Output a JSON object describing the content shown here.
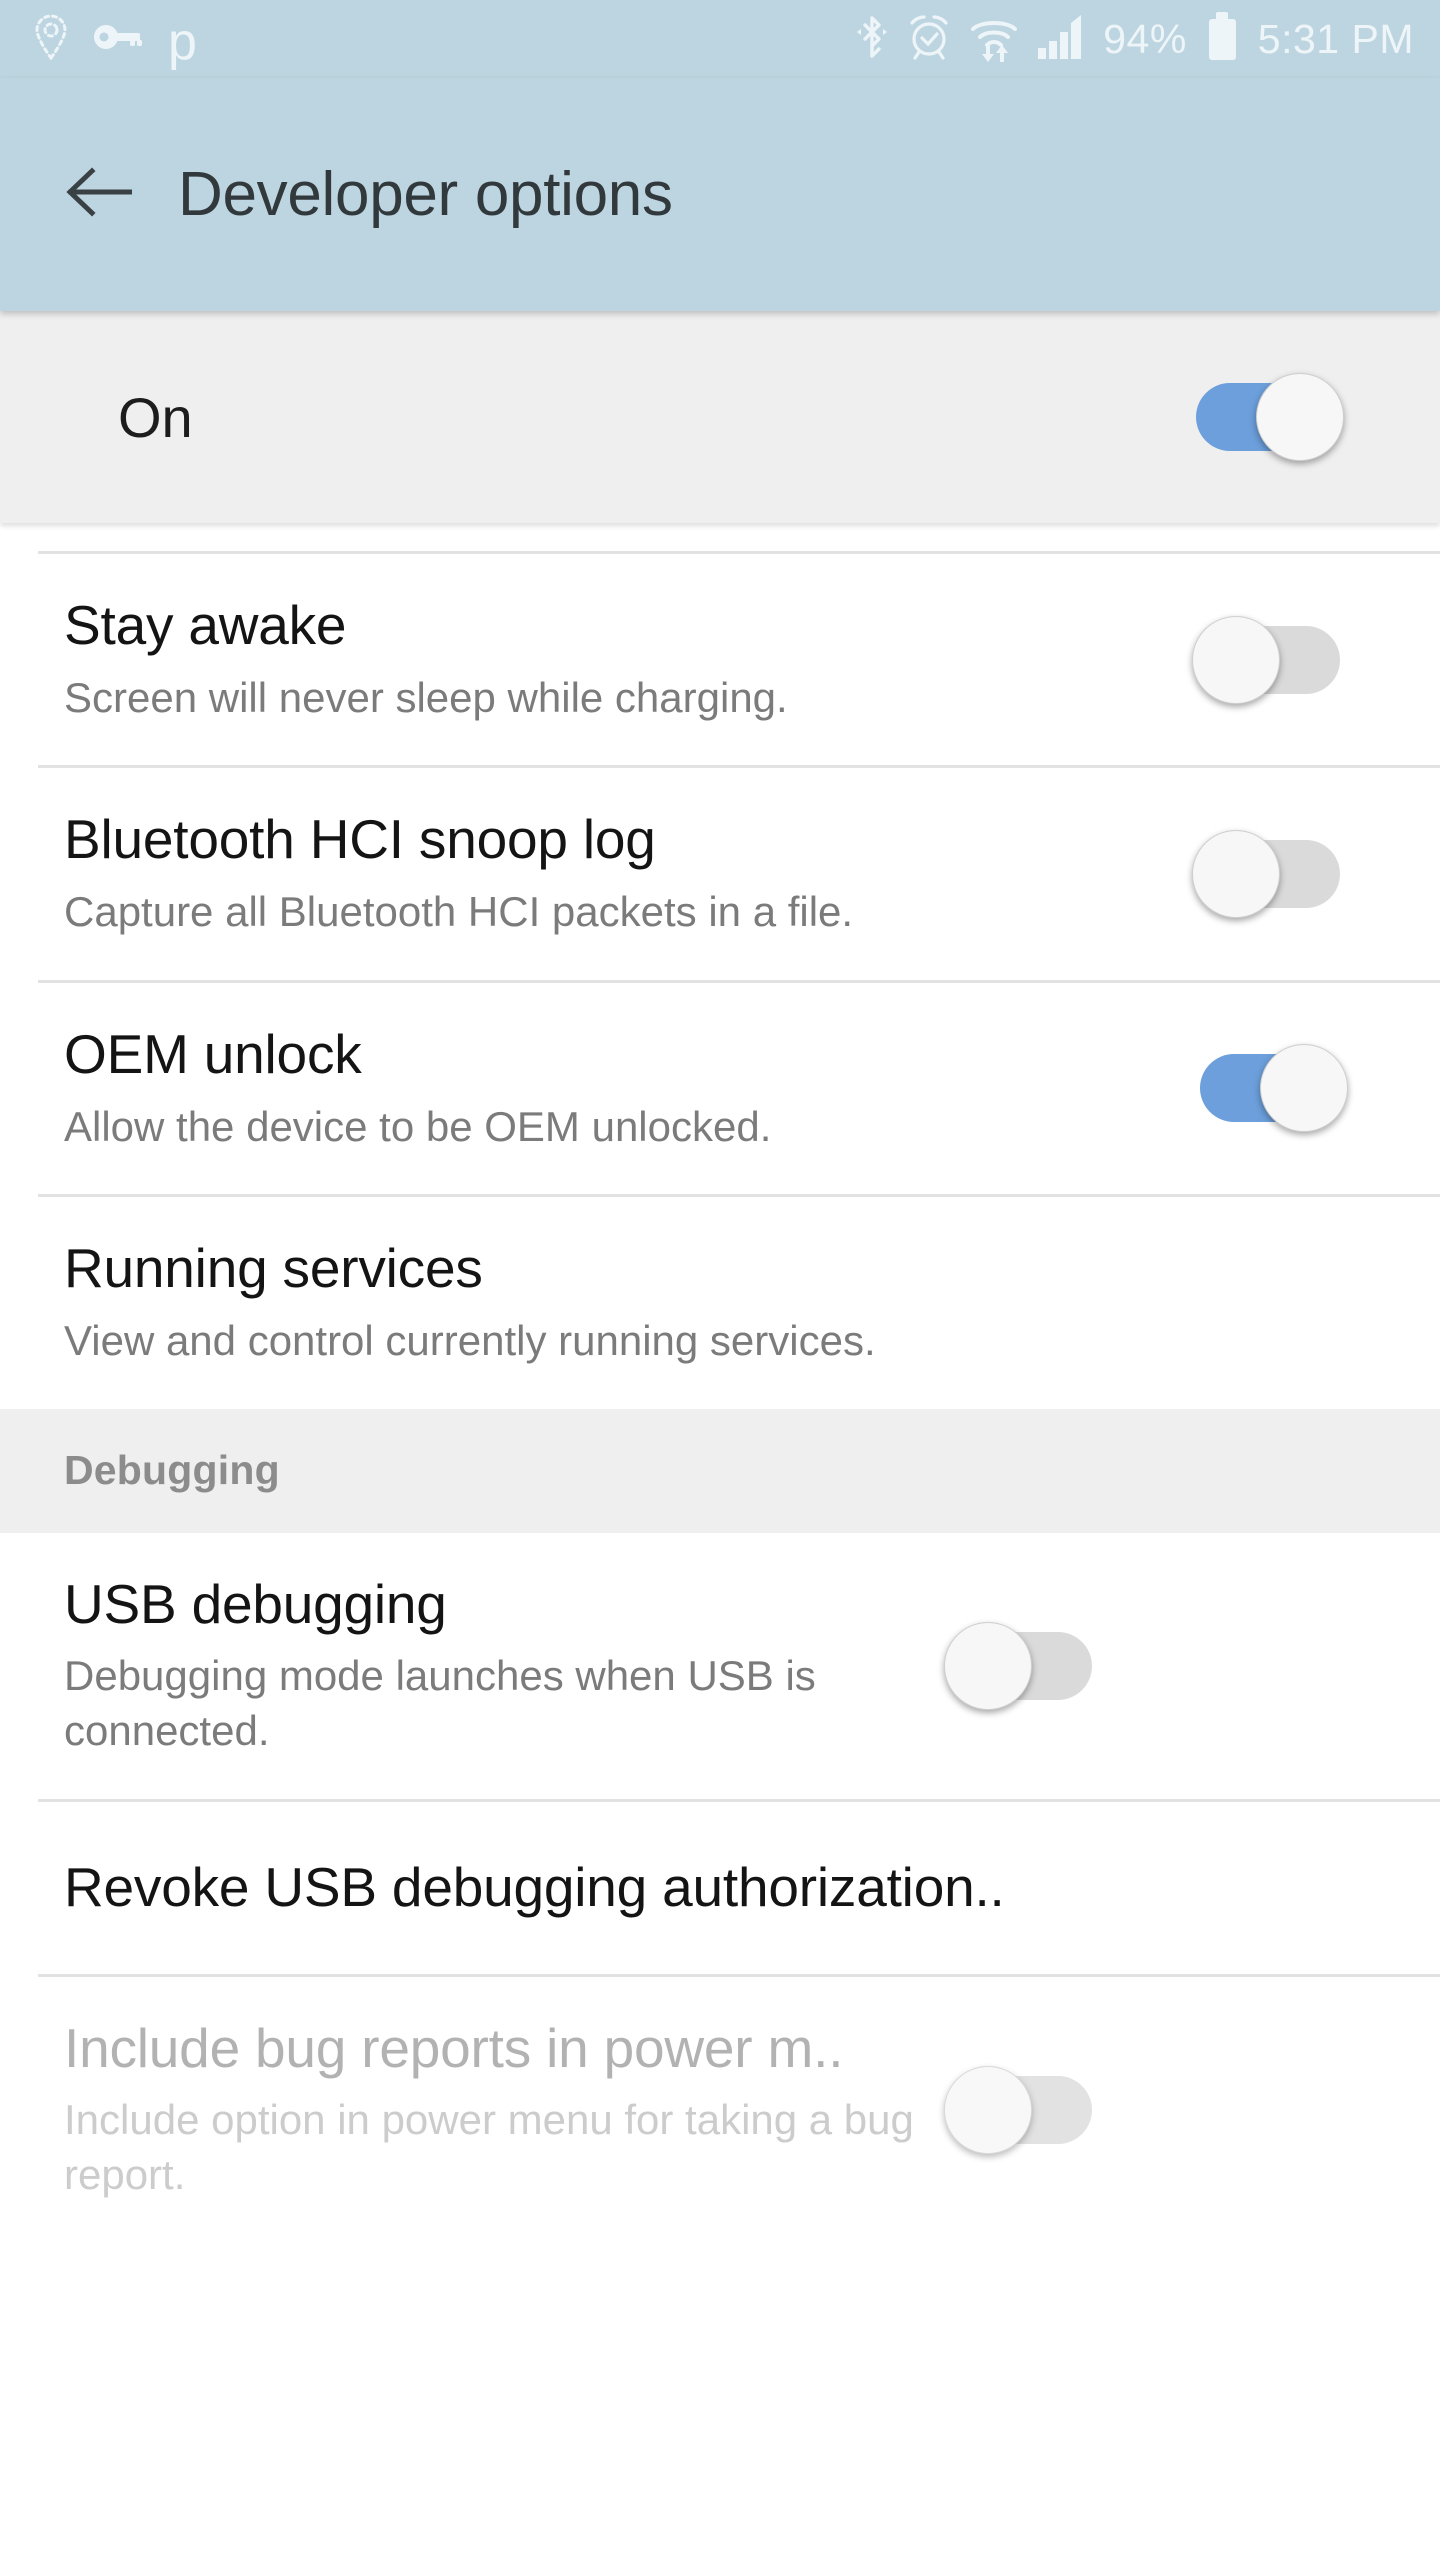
{
  "status_bar": {
    "background_color": "#bdd5e0",
    "icon_color": "#eef5f8",
    "left_icons": [
      {
        "name": "location-pin-icon"
      },
      {
        "name": "vpn-key-icon"
      },
      {
        "name": "app-p-icon",
        "glyph": "p"
      }
    ],
    "right_icons": [
      {
        "name": "bluetooth-icon"
      },
      {
        "name": "alarm-clock-icon"
      },
      {
        "name": "wifi-transfer-icon"
      },
      {
        "name": "cellular-signal-icon"
      }
    ],
    "battery_percent": "94%",
    "time": "5:31 PM"
  },
  "app_bar": {
    "background_color": "#bdd5e0",
    "back_icon": "arrow-left-icon",
    "title": "Developer options"
  },
  "master_switch": {
    "label": "On",
    "enabled": true,
    "background_color": "#efefef"
  },
  "colors": {
    "accent_on": "#6c9fdb",
    "track_off": "#dadada",
    "thumb": "#f7f7f7",
    "title_text": "#141414",
    "summary_text": "#7b7b7b",
    "disabled_title_text": "#b2b2b2",
    "disabled_summary_text": "#cccccc",
    "section_header_text": "#8c8c8c",
    "divider": "#e2e2e2"
  },
  "sections": [
    {
      "header": null,
      "items": [
        {
          "name": "stay-awake",
          "title": "Stay awake",
          "summary": "Screen will never sleep while charging.",
          "control": "switch",
          "enabled": false,
          "disabled": false
        },
        {
          "name": "bluetooth-hci-snoop-log",
          "title": "Bluetooth HCI snoop log",
          "summary": "Capture all Bluetooth HCI packets in a file.",
          "control": "switch",
          "enabled": false,
          "disabled": false
        },
        {
          "name": "oem-unlock",
          "title": "OEM unlock",
          "summary": "Allow the device to be OEM unlocked.",
          "control": "switch",
          "enabled": true,
          "disabled": false
        },
        {
          "name": "running-services",
          "title": "Running services",
          "summary": "View and control currently running services.",
          "control": "none",
          "enabled": false,
          "disabled": false
        }
      ]
    },
    {
      "header": "Debugging",
      "items": [
        {
          "name": "usb-debugging",
          "title": "USB debugging",
          "summary": "Debugging mode launches when USB is connected.",
          "control": "switch",
          "enabled": false,
          "disabled": false
        },
        {
          "name": "revoke-usb-debugging-authorization",
          "title": "Revoke USB debugging authorization..",
          "summary": null,
          "control": "none",
          "enabled": false,
          "disabled": false
        },
        {
          "name": "include-bug-reports-in-power-menu",
          "title": "Include bug reports in power m..",
          "summary": "Include option in power menu for taking a bug report.",
          "control": "switch",
          "enabled": false,
          "disabled": true
        }
      ]
    }
  ]
}
